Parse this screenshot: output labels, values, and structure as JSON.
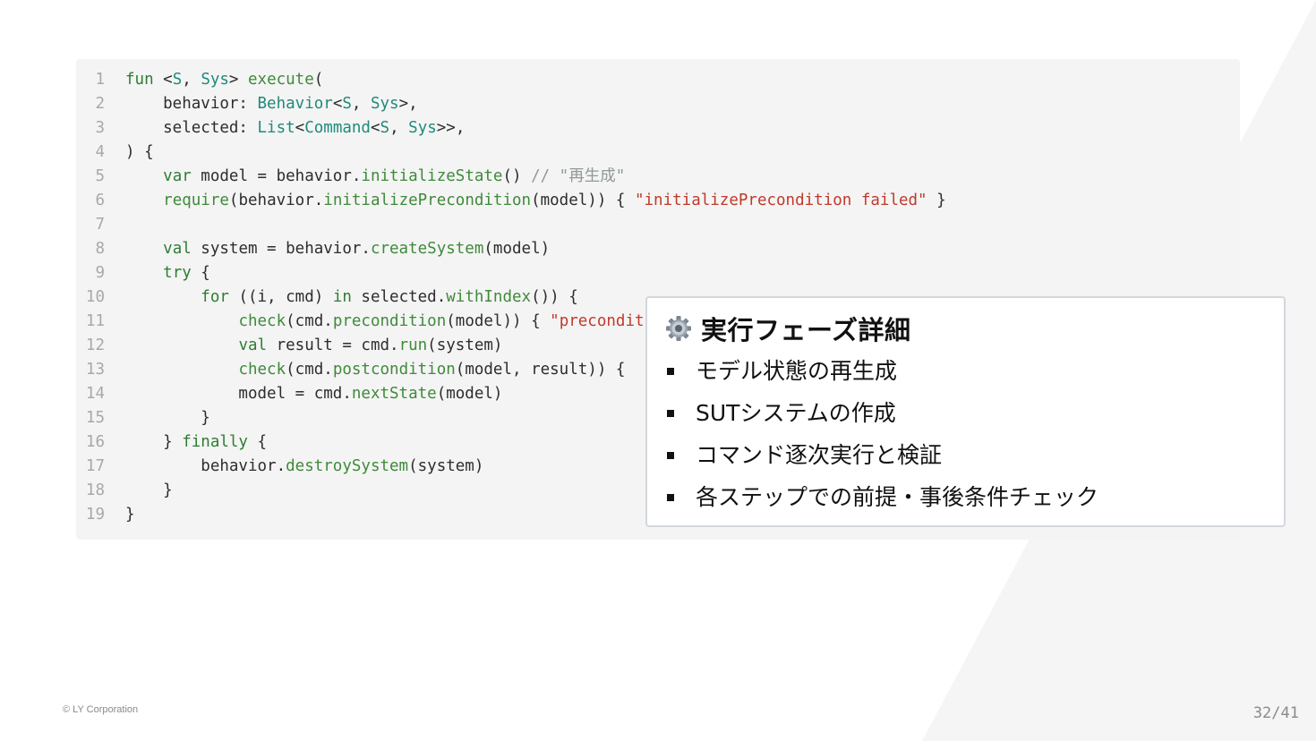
{
  "code": {
    "lines": [
      {
        "n": "1",
        "tokens": [
          {
            "t": "fun",
            "c": "keyword"
          },
          {
            "t": " <",
            "c": "plain"
          },
          {
            "t": "S",
            "c": "type"
          },
          {
            "t": ", ",
            "c": "plain"
          },
          {
            "t": "Sys",
            "c": "type"
          },
          {
            "t": "> ",
            "c": "plain"
          },
          {
            "t": "execute",
            "c": "fn"
          },
          {
            "t": "(",
            "c": "plain"
          }
        ]
      },
      {
        "n": "2",
        "tokens": [
          {
            "t": "    behavior: ",
            "c": "plain"
          },
          {
            "t": "Behavior",
            "c": "type"
          },
          {
            "t": "<",
            "c": "plain"
          },
          {
            "t": "S",
            "c": "type"
          },
          {
            "t": ", ",
            "c": "plain"
          },
          {
            "t": "Sys",
            "c": "type"
          },
          {
            "t": ">,",
            "c": "plain"
          }
        ]
      },
      {
        "n": "3",
        "tokens": [
          {
            "t": "    selected: ",
            "c": "plain"
          },
          {
            "t": "List",
            "c": "type"
          },
          {
            "t": "<",
            "c": "plain"
          },
          {
            "t": "Command",
            "c": "type"
          },
          {
            "t": "<",
            "c": "plain"
          },
          {
            "t": "S",
            "c": "type"
          },
          {
            "t": ", ",
            "c": "plain"
          },
          {
            "t": "Sys",
            "c": "type"
          },
          {
            "t": ">>,",
            "c": "plain"
          }
        ]
      },
      {
        "n": "4",
        "tokens": [
          {
            "t": ") {",
            "c": "plain"
          }
        ]
      },
      {
        "n": "5",
        "tokens": [
          {
            "t": "    ",
            "c": "plain"
          },
          {
            "t": "var",
            "c": "keyword"
          },
          {
            "t": " model = behavior.",
            "c": "plain"
          },
          {
            "t": "initializeState",
            "c": "fn"
          },
          {
            "t": "() ",
            "c": "plain"
          },
          {
            "t": "// \"再生成\"",
            "c": "comment"
          }
        ]
      },
      {
        "n": "6",
        "tokens": [
          {
            "t": "    ",
            "c": "plain"
          },
          {
            "t": "require",
            "c": "fn"
          },
          {
            "t": "(behavior.",
            "c": "plain"
          },
          {
            "t": "initializePrecondition",
            "c": "fn"
          },
          {
            "t": "(model)) { ",
            "c": "plain"
          },
          {
            "t": "\"initializePrecondition failed\"",
            "c": "string"
          },
          {
            "t": " }",
            "c": "plain"
          }
        ]
      },
      {
        "n": "7",
        "tokens": []
      },
      {
        "n": "8",
        "tokens": [
          {
            "t": "    ",
            "c": "plain"
          },
          {
            "t": "val",
            "c": "keyword"
          },
          {
            "t": " system = behavior.",
            "c": "plain"
          },
          {
            "t": "createSystem",
            "c": "fn"
          },
          {
            "t": "(model)",
            "c": "plain"
          }
        ]
      },
      {
        "n": "9",
        "tokens": [
          {
            "t": "    ",
            "c": "plain"
          },
          {
            "t": "try",
            "c": "keyword"
          },
          {
            "t": " {",
            "c": "plain"
          }
        ]
      },
      {
        "n": "10",
        "tokens": [
          {
            "t": "        ",
            "c": "plain"
          },
          {
            "t": "for",
            "c": "keyword"
          },
          {
            "t": " ((i, cmd) ",
            "c": "plain"
          },
          {
            "t": "in",
            "c": "keyword"
          },
          {
            "t": " selected.",
            "c": "plain"
          },
          {
            "t": "withIndex",
            "c": "fn"
          },
          {
            "t": "()) {",
            "c": "plain"
          }
        ]
      },
      {
        "n": "11",
        "tokens": [
          {
            "t": "            ",
            "c": "plain"
          },
          {
            "t": "check",
            "c": "fn"
          },
          {
            "t": "(cmd.",
            "c": "plain"
          },
          {
            "t": "precondition",
            "c": "fn"
          },
          {
            "t": "(model)) { ",
            "c": "plain"
          },
          {
            "t": "\"precondit",
            "c": "string"
          }
        ]
      },
      {
        "n": "12",
        "tokens": [
          {
            "t": "            ",
            "c": "plain"
          },
          {
            "t": "val",
            "c": "keyword"
          },
          {
            "t": " result = cmd.",
            "c": "plain"
          },
          {
            "t": "run",
            "c": "fn"
          },
          {
            "t": "(system)",
            "c": "plain"
          }
        ]
      },
      {
        "n": "13",
        "tokens": [
          {
            "t": "            ",
            "c": "plain"
          },
          {
            "t": "check",
            "c": "fn"
          },
          {
            "t": "(cmd.",
            "c": "plain"
          },
          {
            "t": "postcondition",
            "c": "fn"
          },
          {
            "t": "(model, result)) { ",
            "c": "plain"
          }
        ]
      },
      {
        "n": "14",
        "tokens": [
          {
            "t": "            model = cmd.",
            "c": "plain"
          },
          {
            "t": "nextState",
            "c": "fn"
          },
          {
            "t": "(model)",
            "c": "plain"
          }
        ]
      },
      {
        "n": "15",
        "tokens": [
          {
            "t": "        }",
            "c": "plain"
          }
        ]
      },
      {
        "n": "16",
        "tokens": [
          {
            "t": "    } ",
            "c": "plain"
          },
          {
            "t": "finally",
            "c": "keyword"
          },
          {
            "t": " {",
            "c": "plain"
          }
        ]
      },
      {
        "n": "17",
        "tokens": [
          {
            "t": "        behavior.",
            "c": "plain"
          },
          {
            "t": "destroySystem",
            "c": "fn"
          },
          {
            "t": "(system)",
            "c": "plain"
          }
        ]
      },
      {
        "n": "18",
        "tokens": [
          {
            "t": "    }",
            "c": "plain"
          }
        ]
      },
      {
        "n": "19",
        "tokens": [
          {
            "t": "}",
            "c": "plain"
          }
        ]
      }
    ]
  },
  "popup": {
    "title": "実行フェーズ詳細",
    "icon": "gear-icon",
    "items": [
      "モデル状態の再生成",
      "SUTシステムの作成",
      "コマンド逐次実行と検証",
      "各ステップでの前提・事後条件チェック"
    ]
  },
  "footer": {
    "copyright": "© LY Corporation",
    "page": "32/41"
  }
}
